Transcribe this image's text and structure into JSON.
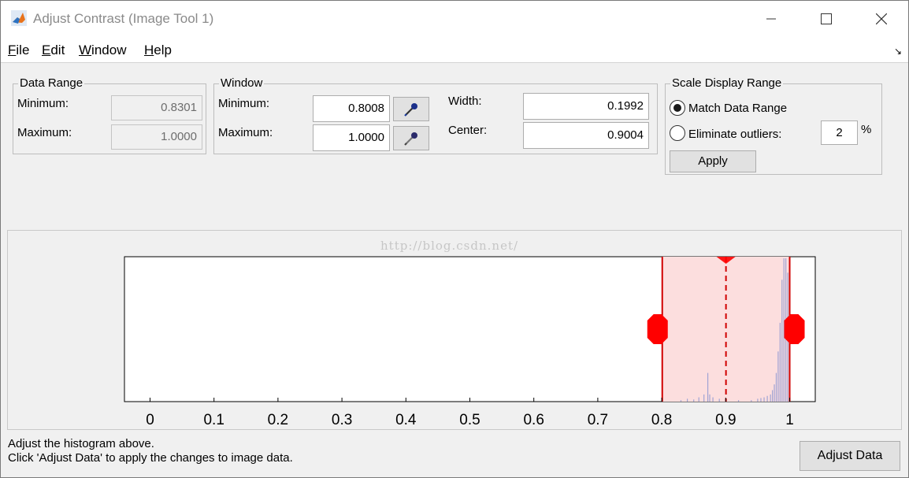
{
  "window": {
    "title": "Adjust Contrast (Image Tool 1)",
    "min_icon": "minimize-icon",
    "max_icon": "maximize-icon",
    "close_icon": "close-icon"
  },
  "menu": [
    {
      "label": "File",
      "mnemonic": "F",
      "rest": "ile"
    },
    {
      "label": "Edit",
      "mnemonic": "E",
      "rest": "dit"
    },
    {
      "label": "Window",
      "mnemonic": "W",
      "rest": "indow"
    },
    {
      "label": "Help",
      "mnemonic": "H",
      "rest": "elp"
    }
  ],
  "data_range": {
    "title": "Data Range",
    "min_label": "Minimum:",
    "min_value": "0.8301",
    "max_label": "Maximum:",
    "max_value": "1.0000"
  },
  "window_panel": {
    "title": "Window",
    "min_label": "Minimum:",
    "min_value": "0.8008",
    "max_label": "Maximum:",
    "max_value": "1.0000",
    "width_label": "Width:",
    "width_value": "0.1992",
    "center_label": "Center:",
    "center_value": "0.9004"
  },
  "scale_range": {
    "title": "Scale Display Range",
    "match_label": "Match Data Range",
    "eliminate_label": "Eliminate outliers:",
    "outlier_percent": "2",
    "percent_sign": "%",
    "apply_label": "Apply",
    "selected": "match"
  },
  "watermark": "http://blog.csdn.net/",
  "chart_data": {
    "type": "bar",
    "title": "",
    "xlim": [
      -0.04,
      1.04
    ],
    "x_ticks": [
      "0",
      "0.1",
      "0.2",
      "0.3",
      "0.4",
      "0.5",
      "0.6",
      "0.7",
      "0.8",
      "0.9",
      "1"
    ],
    "window_min": 0.8008,
    "window_max": 1.0,
    "window_center": 0.9004,
    "colors": {
      "window_fill": "#fcdede",
      "window_edge": "#d00000",
      "handle": "#ff0000",
      "bars": "#9fa3d4"
    },
    "x": [
      0.83,
      0.84,
      0.85,
      0.858,
      0.866,
      0.872,
      0.875,
      0.88,
      0.89,
      0.9,
      0.92,
      0.94,
      0.95,
      0.955,
      0.96,
      0.965,
      0.97,
      0.973,
      0.976,
      0.979,
      0.982,
      0.985,
      0.988,
      0.991,
      0.994,
      0.997,
      1.0
    ],
    "values": [
      0.01,
      0.02,
      0.015,
      0.03,
      0.05,
      0.2,
      0.05,
      0.03,
      0.02,
      0.015,
      0.01,
      0.01,
      0.02,
      0.025,
      0.03,
      0.04,
      0.05,
      0.08,
      0.12,
      0.2,
      0.35,
      0.55,
      0.85,
      1.0,
      1.0,
      0.9,
      0.7
    ]
  },
  "status": {
    "line1": "Adjust the histogram above.",
    "line2": "Click 'Adjust Data' to apply the changes to image data."
  },
  "adjust_button": "Adjust Data"
}
